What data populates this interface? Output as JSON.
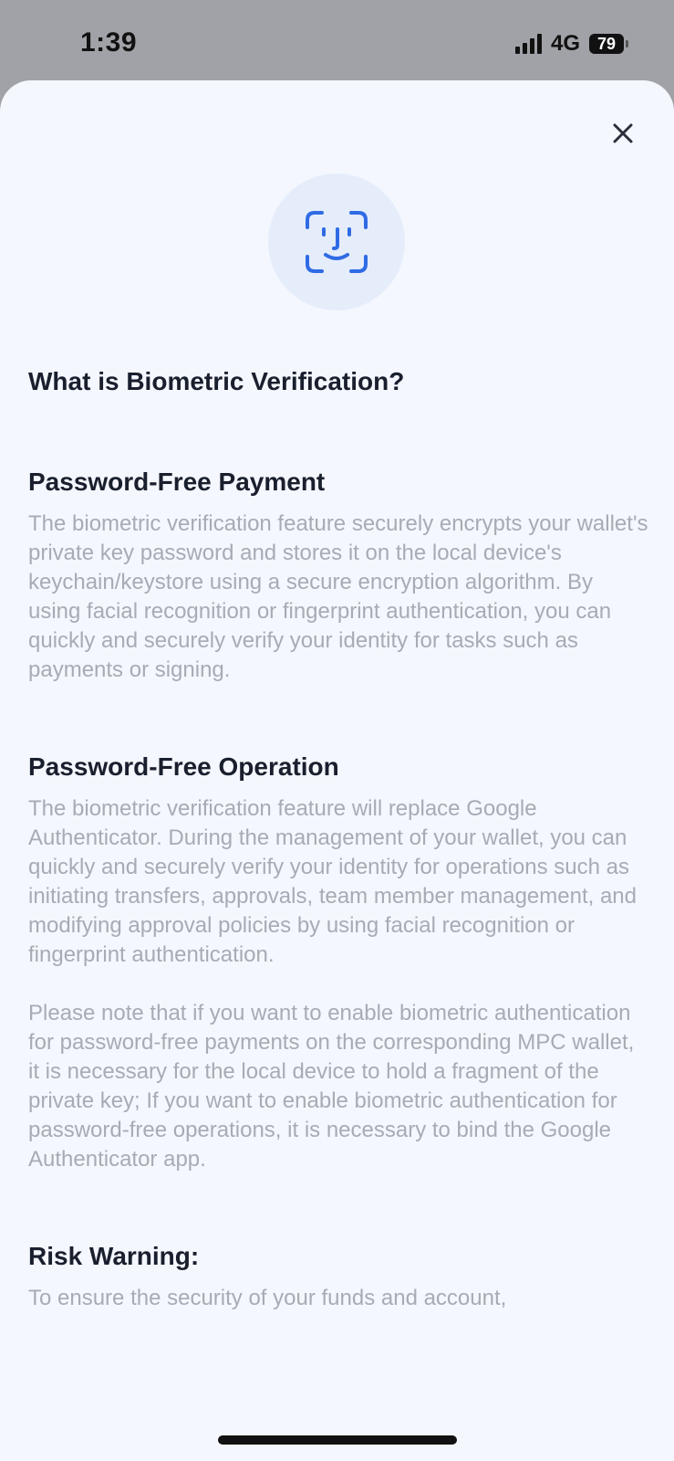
{
  "status": {
    "time": "1:39",
    "network": "4G",
    "battery": "79"
  },
  "sheet": {
    "title": "What is Biometric Verification?",
    "sections": [
      {
        "title": "Password-Free Payment",
        "paragraphs": [
          "The biometric verification feature securely encrypts your wallet's private key password and stores it on the local device's keychain/keystore using a secure encryption algorithm. By using facial recognition or fingerprint authentication, you can quickly and securely verify your identity for tasks such as payments or signing."
        ]
      },
      {
        "title": "Password-Free Operation",
        "paragraphs": [
          "The biometric verification feature will replace Google Authenticator. During the management of your wallet, you can quickly and securely verify your identity for operations such as initiating transfers, approvals, team member management, and modifying approval policies by using facial recognition or fingerprint authentication.",
          "Please note that if you want to enable biometric authentication for password-free payments on the corresponding MPC wallet, it is necessary for the local device to hold a fragment of the private key; If you want to enable biometric authentication for password-free operations, it is necessary to bind the Google Authenticator app."
        ]
      },
      {
        "title": "Risk Warning:",
        "paragraphs": [
          "To ensure the security of your funds and account,"
        ]
      }
    ]
  },
  "icons": {
    "close": "close-icon",
    "hero": "face-id-icon",
    "accent": "#2f6be4"
  }
}
